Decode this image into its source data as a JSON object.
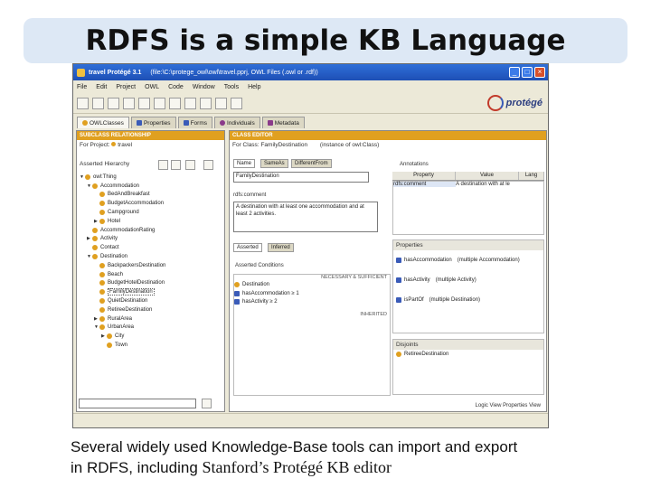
{
  "slide": {
    "title": "RDFS is a simple KB Language",
    "caption_line1": "Several widely used Knowledge-Base tools can import and export",
    "caption_line2a": "in RDFS, including ",
    "caption_line2b": "Stanford’s Protégé KB editor"
  },
  "window": {
    "title": "travel  Protégé 3.1",
    "path": "(file:\\C:\\protege_owl\\owl\\travel.pprj, OWL Files (.owl or .rdf))",
    "menu": [
      "File",
      "Edit",
      "Project",
      "OWL",
      "Code",
      "Window",
      "Tools",
      "Help"
    ],
    "logo": "protégé",
    "tabs": [
      "OWLClasses",
      "Properties",
      "Forms",
      "Individuals",
      "Metadata"
    ]
  },
  "subclass_panel": {
    "header": "SUBCLASS RELATIONSHIP",
    "for_project_label": "For Project:",
    "for_project_value": "travel",
    "hierarchy_label": "Asserted Hierarchy",
    "tree": [
      {
        "label": "owl:Thing",
        "level": 0,
        "toggle": "▼"
      },
      {
        "label": "Accommodation",
        "level": 1,
        "toggle": "▼"
      },
      {
        "label": "BedAndBreakfast",
        "level": 2,
        "toggle": ""
      },
      {
        "label": "BudgetAccommodation",
        "level": 2,
        "toggle": ""
      },
      {
        "label": "Campground",
        "level": 2,
        "toggle": ""
      },
      {
        "label": "Hotel",
        "level": 2,
        "toggle": "▶"
      },
      {
        "label": "AccommodationRating",
        "level": 1,
        "toggle": ""
      },
      {
        "label": "Activity",
        "level": 1,
        "toggle": "▶"
      },
      {
        "label": "Contact",
        "level": 1,
        "toggle": ""
      },
      {
        "label": "Destination",
        "level": 1,
        "toggle": "▼"
      },
      {
        "label": "BackpackersDestination",
        "level": 2,
        "toggle": ""
      },
      {
        "label": "Beach",
        "level": 2,
        "toggle": ""
      },
      {
        "label": "BudgetHotelDestination",
        "level": 2,
        "toggle": ""
      },
      {
        "label": "FamilyDestination",
        "level": 2,
        "toggle": "",
        "selected": true
      },
      {
        "label": "QuietDestination",
        "level": 2,
        "toggle": ""
      },
      {
        "label": "RetireeDestination",
        "level": 2,
        "toggle": ""
      },
      {
        "label": "RuralArea",
        "level": 2,
        "toggle": "▶"
      },
      {
        "label": "UrbanArea",
        "level": 2,
        "toggle": "▼"
      },
      {
        "label": "City",
        "level": 3,
        "toggle": "▶"
      },
      {
        "label": "Town",
        "level": 3,
        "toggle": ""
      }
    ]
  },
  "class_editor": {
    "header": "CLASS EDITOR",
    "for_class_label": "For Class:",
    "for_class_value": "FamilyDestination",
    "instance_of": "(instance of owl:Class)",
    "subtabs": [
      "Name",
      "SameAs",
      "DifferentFrom"
    ],
    "name_value": "FamilyDestination",
    "comment_label": "rdfs:comment",
    "comment_text": "A destination with at least one accommodation and at least 2 activities.",
    "annotations_label": "Annotations",
    "ann_cols": [
      "Property",
      "Value",
      "Lang"
    ],
    "ann_row_prop": "rdfs:comment",
    "ann_row_value": "A destination with at le",
    "cond_tabs": [
      "Asserted",
      "Inferred"
    ],
    "conditions_label": "Asserted Conditions",
    "necessary_sufficient": "NECESSARY & SUFFICIENT",
    "conditions": [
      "Destination",
      "hasAccommodation ≥ 1",
      "hasActivity ≥ 2"
    ],
    "inherited": "INHERITED",
    "properties_label": "Properties",
    "properties": [
      {
        "name": "hasAccommodation",
        "range": "(multiple Accommodation)"
      },
      {
        "name": "hasActivity",
        "range": "(multiple Activity)"
      },
      {
        "name": "isPartOf",
        "range": "(multiple Destination)"
      }
    ],
    "disjoints_label": "Disjoints",
    "disjoint_item": "RetireeDestination",
    "status_right": "Logic View   Properties View"
  }
}
